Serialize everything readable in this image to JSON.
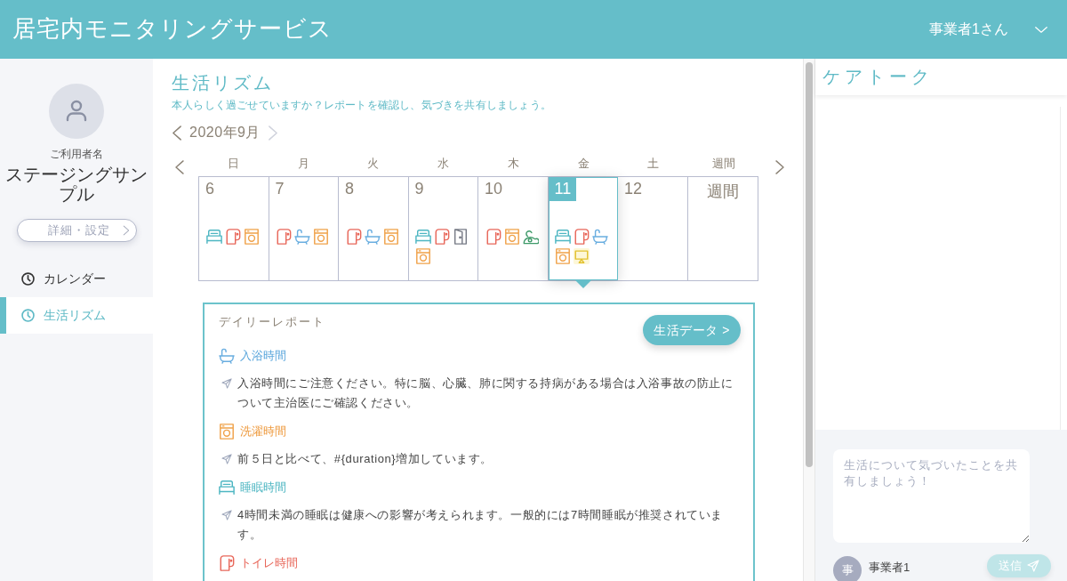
{
  "header": {
    "title": "居宅内モニタリングサービス",
    "user": "事業者1さん"
  },
  "sidebar": {
    "user_label": "ご利用者名",
    "user_name": "ステージングサンプル",
    "settings_button": "詳細・設定",
    "nav": [
      {
        "label": "カレンダー",
        "selected": false
      },
      {
        "label": "生活リズム",
        "selected": true
      }
    ]
  },
  "rhythm": {
    "title": "生活リズム",
    "subtitle": "本人らしく過ごせていますか？レポートを確認し、気づきを共有しましょう。",
    "month": "2020年9月",
    "prev_month_disabled": false,
    "next_month_disabled": true
  },
  "calendar": {
    "weekdays": [
      "日",
      "月",
      "火",
      "水",
      "木",
      "金",
      "土",
      "週間"
    ],
    "days": [
      {
        "date": "6",
        "selected": false,
        "events": [
          {
            "kind": "sleep"
          },
          {
            "kind": "toilet"
          },
          {
            "kind": "laundry"
          }
        ]
      },
      {
        "date": "7",
        "selected": false,
        "events": [
          {
            "kind": "toilet"
          },
          {
            "kind": "bath"
          },
          {
            "kind": "laundry"
          }
        ]
      },
      {
        "date": "8",
        "selected": false,
        "events": [
          {
            "kind": "toilet"
          },
          {
            "kind": "bath"
          },
          {
            "kind": "laundry"
          }
        ]
      },
      {
        "date": "9",
        "selected": false,
        "events": [
          {
            "kind": "sleep"
          },
          {
            "kind": "toilet"
          },
          {
            "kind": "door"
          },
          {
            "kind": "laundry"
          }
        ]
      },
      {
        "date": "10",
        "selected": false,
        "events": [
          {
            "kind": "toilet"
          },
          {
            "kind": "laundry"
          },
          {
            "kind": "cleaning"
          }
        ]
      },
      {
        "date": "11",
        "selected": true,
        "events": [
          {
            "kind": "sleep"
          },
          {
            "kind": "toilet"
          },
          {
            "kind": "bath"
          },
          {
            "kind": "laundry"
          },
          {
            "kind": "tv"
          }
        ]
      },
      {
        "date": "12",
        "selected": false
      }
    ],
    "week_cell": "週間"
  },
  "daily_report": {
    "title": "デイリーレポート",
    "button": "生活データ >",
    "sections": [
      {
        "kind": "bath",
        "title": "入浴時間",
        "message": "入浴時間にご注意ください。特に脳、心臓、肺に関する持病がある場合は入浴事故の防止について主治医にご確認ください。"
      },
      {
        "kind": "laundry",
        "title": "洗濯時間",
        "message": "前５日と比べて、#{duration}増加しています。"
      },
      {
        "kind": "sleep",
        "title": "睡眠時間",
        "message": "4時間未満の睡眠は健康への影響が考えられます。一般的には7時間睡眠が推奨されています。"
      },
      {
        "kind": "toilet",
        "title": "トイレ時間"
      }
    ]
  },
  "care_talk": {
    "title": "ケアトーク",
    "placeholder": "生活について気づいたことを共有しましょう！",
    "author_initial": "事",
    "author_name": "事業者1",
    "send_button": "送信",
    "send_disabled": true
  }
}
